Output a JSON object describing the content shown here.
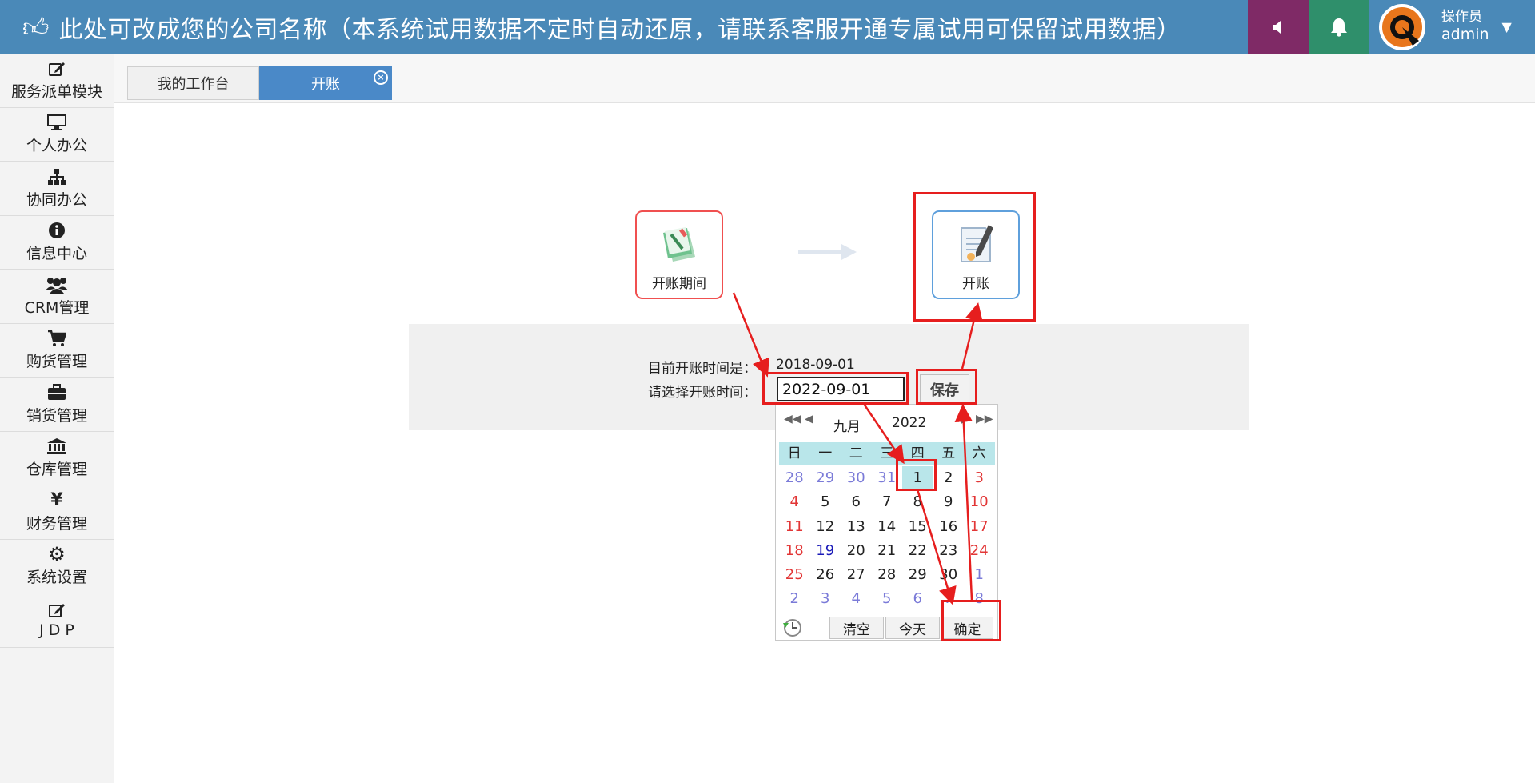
{
  "header": {
    "brand_text": "此处可改成您的公司名称（本系统试用数据不定时自动还原，请联系客服开通专属试用可保留试用数据）",
    "user_role": "操作员",
    "user_name": "admin"
  },
  "sidebar": {
    "items": [
      {
        "label": "服务派单模块",
        "icon": "edit-icon"
      },
      {
        "label": "个人办公",
        "icon": "desktop-icon"
      },
      {
        "label": "协同办公",
        "icon": "sitemap-icon"
      },
      {
        "label": "信息中心",
        "icon": "info-circle-icon"
      },
      {
        "label": "CRM管理",
        "icon": "users-icon"
      },
      {
        "label": "购货管理",
        "icon": "shopping-cart-icon"
      },
      {
        "label": "销货管理",
        "icon": "briefcase-icon"
      },
      {
        "label": "仓库管理",
        "icon": "bank-icon"
      },
      {
        "label": "财务管理",
        "icon": "yen-icon"
      },
      {
        "label": "系统设置",
        "icon": "gear-icon"
      },
      {
        "label": "J D P",
        "icon": "edit-icon"
      }
    ]
  },
  "tabs": [
    {
      "label": "我的工作台",
      "active": false
    },
    {
      "label": "开账",
      "active": true
    }
  ],
  "steps": [
    {
      "label": "开账期间"
    },
    {
      "label": "开账"
    }
  ],
  "form": {
    "current_label": "目前开账时间是：",
    "current_value": "2018-09-01",
    "select_label": "请选择开账时间：",
    "date_value": "2022-09-01",
    "save_label": "保存"
  },
  "calendar": {
    "month": "九月",
    "year": "2022",
    "weekdays": [
      "日",
      "一",
      "二",
      "三",
      "四",
      "五",
      "六"
    ],
    "days": [
      "28",
      "29",
      "30",
      "31",
      "1",
      "2",
      "3",
      "4",
      "5",
      "6",
      "7",
      "8",
      "9",
      "10",
      "11",
      "12",
      "13",
      "14",
      "15",
      "16",
      "17",
      "18",
      "19",
      "20",
      "21",
      "22",
      "23",
      "24",
      "25",
      "26",
      "27",
      "28",
      "29",
      "30",
      "1",
      "2",
      "3",
      "4",
      "5",
      "6",
      "7",
      "8"
    ],
    "selected_day": "1",
    "today_day": "19",
    "clear_label": "清空",
    "today_label": "今天",
    "ok_label": "确定"
  },
  "colors": {
    "header": "#4a89b8",
    "sound_button": "#7f2a66",
    "bell_button": "#2f8f6b",
    "active_tab": "#4a89c8",
    "annotation": "#e61e1e",
    "calendar_header": "#b9e6ea"
  }
}
